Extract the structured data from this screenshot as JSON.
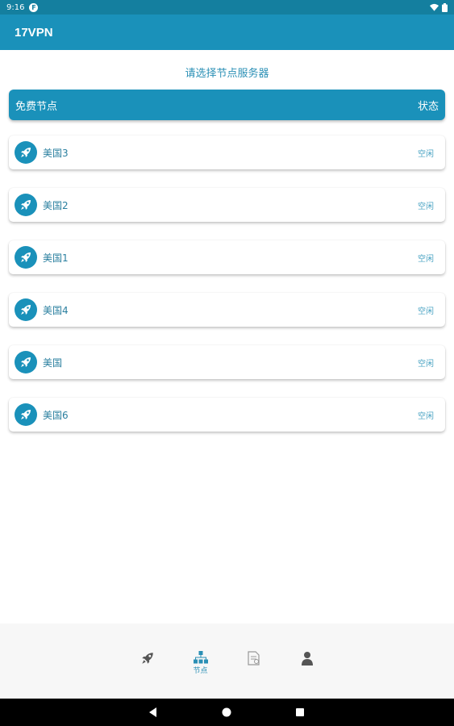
{
  "status_bar": {
    "time": "9:16",
    "app_icon_letter": "F"
  },
  "app_bar": {
    "title": "17VPN",
    "color": "#1a91ba"
  },
  "subtitle": "请选择节点服务器",
  "list_header": {
    "left": "免费节点",
    "right": "状态"
  },
  "nodes": [
    {
      "name": "美国3",
      "status": "空闲"
    },
    {
      "name": "美国2",
      "status": "空闲"
    },
    {
      "name": "美国1",
      "status": "空闲"
    },
    {
      "name": "美国4",
      "status": "空闲"
    },
    {
      "name": "美国",
      "status": "空闲"
    },
    {
      "name": "美国6",
      "status": "空闲"
    }
  ],
  "bottom_nav": {
    "items": [
      {
        "icon": "rocket-icon",
        "label": ""
      },
      {
        "icon": "network-icon",
        "label": "节点"
      },
      {
        "icon": "document-icon",
        "label": ""
      },
      {
        "icon": "user-icon",
        "label": ""
      }
    ],
    "active_index": 1
  },
  "system_nav": {
    "buttons": [
      "back-icon",
      "home-icon",
      "recents-icon"
    ]
  }
}
